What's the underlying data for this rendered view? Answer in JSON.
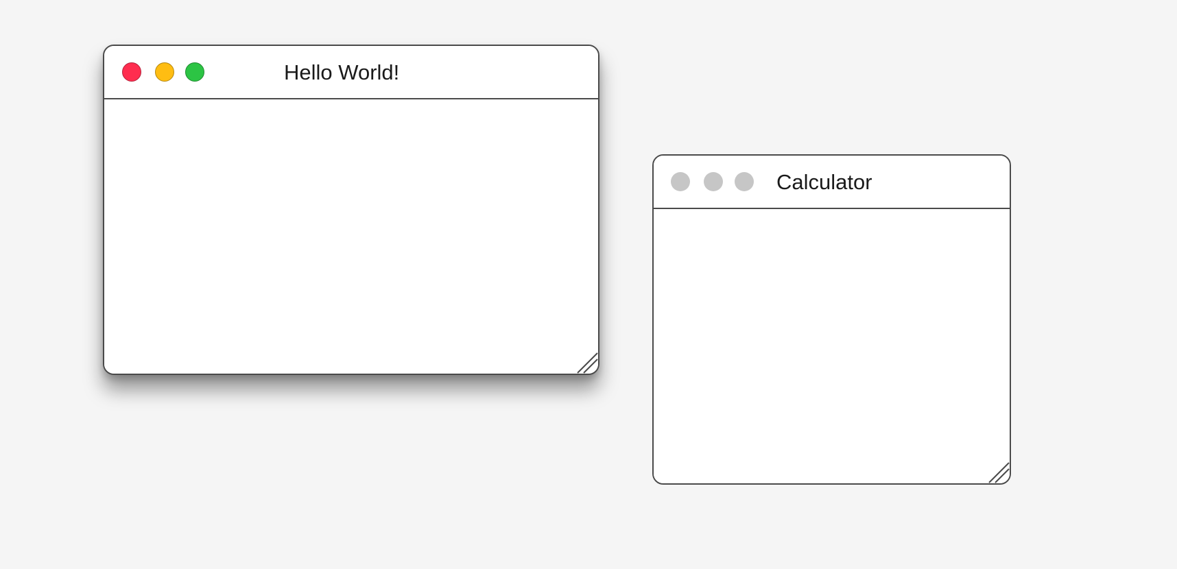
{
  "windows": [
    {
      "title": "Hello World!",
      "active": true,
      "buttons": {
        "close_color": "#ff2d4f",
        "minimize_color": "#ffbd12",
        "zoom_color": "#2cc444"
      }
    },
    {
      "title": "Calculator",
      "active": false,
      "buttons": {
        "close_color": "#c6c6c6",
        "minimize_color": "#c6c6c6",
        "zoom_color": "#c6c6c6"
      }
    }
  ],
  "colors": {
    "desktop": "#f5f5f5",
    "window_border": "#4a4a4a",
    "window_bg": "#ffffff"
  }
}
